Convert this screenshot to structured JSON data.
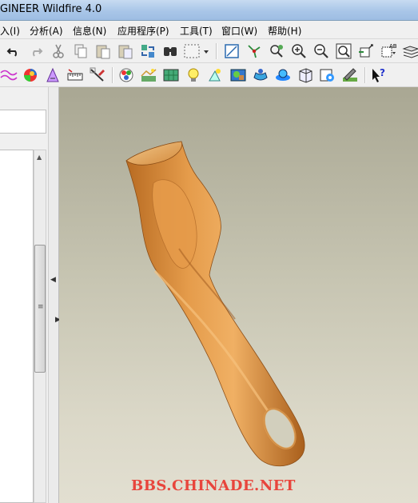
{
  "window": {
    "title": "GINEER Wildfire 4.0"
  },
  "menu": {
    "items": [
      {
        "label": "入(I)"
      },
      {
        "label": "分析(A)"
      },
      {
        "label": "信息(N)"
      },
      {
        "label": "应用程序(P)"
      },
      {
        "label": "工具(T)"
      },
      {
        "label": "窗口(W)"
      },
      {
        "label": "帮助(H)"
      }
    ]
  },
  "toolbar1": {
    "icons": [
      "undo-icon",
      "redo-icon",
      "cut-icon",
      "copy-icon",
      "paste-icon",
      "paste-special-icon",
      "regenerate-icon",
      "find-icon",
      "select-box-icon",
      "dropdown-arrow-icon",
      "redraw-icon",
      "spin-center-icon",
      "orient-icon",
      "zoom-in-icon",
      "zoom-out-icon",
      "refit-icon",
      "reorient-icon",
      "saved-views-icon",
      "layers-icon"
    ]
  },
  "toolbar2": {
    "icons": [
      "curve-analysis-icon",
      "shading-analysis-icon",
      "draft-icon",
      "measure-icon",
      "tolerance-icon",
      "appearance-icon",
      "sketch-icon",
      "texture-icon",
      "light-icon",
      "spotlight-icon",
      "scene-icon",
      "render-room-icon",
      "render-icon",
      "perspective-icon",
      "photo-render-icon",
      "tools-icon",
      "context-help-icon"
    ]
  },
  "viewport": {
    "model": "handle-model",
    "watermark": "BBS.CHINADE.NET"
  },
  "colors": {
    "model": "#d68a3c",
    "watermark": "#e8453c",
    "viewport_top": "#a9a793",
    "viewport_bottom": "#e2dfd1"
  }
}
